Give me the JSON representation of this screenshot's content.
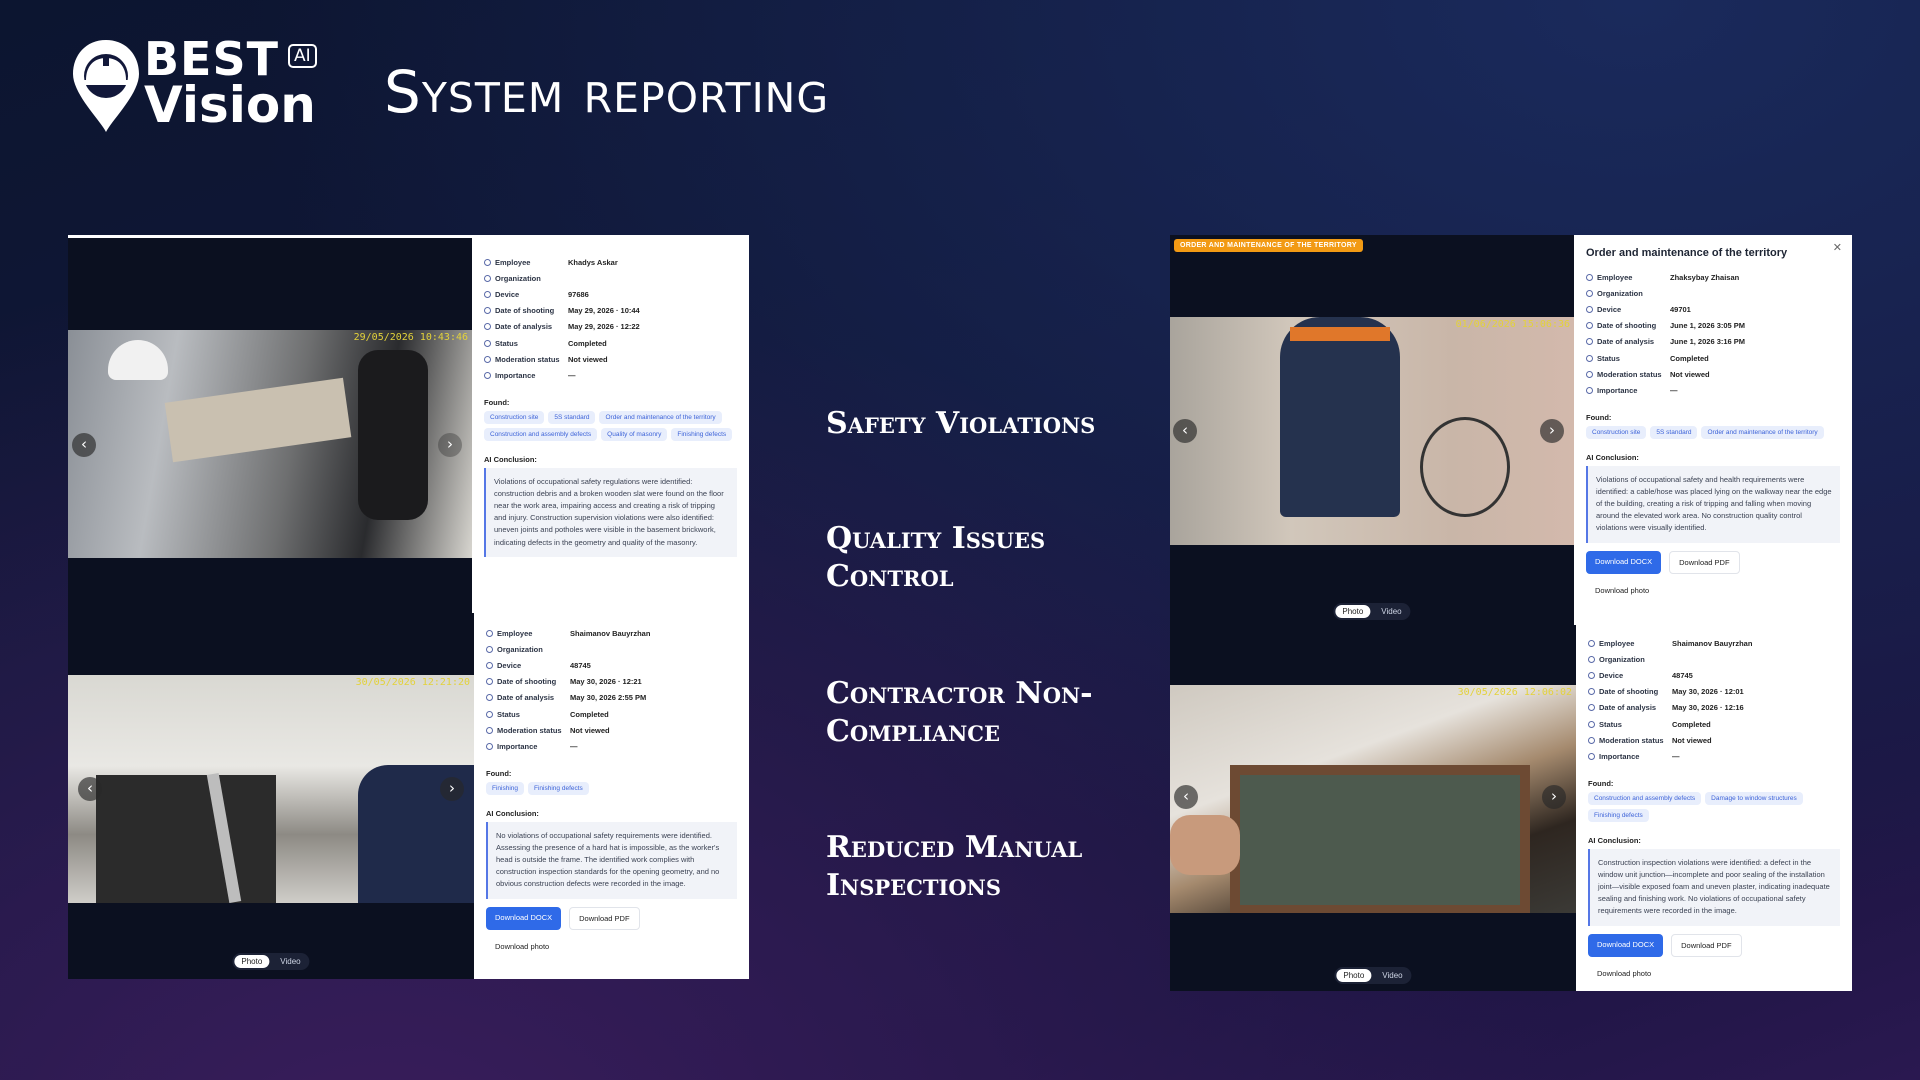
{
  "brand": {
    "line1": "BEST",
    "line2": "Vision",
    "badge": "AI"
  },
  "title": "System reporting",
  "features": [
    "Safety Violations",
    "Quality Issues Control",
    "Contractor Non-Compliance",
    "Reduced Manual Inspections"
  ],
  "labels": {
    "employee": "Employee",
    "organization": "Organization",
    "device": "Device",
    "date_shooting": "Date of shooting",
    "date_analysis": "Date of analysis",
    "status": "Status",
    "moderation": "Moderation status",
    "importance": "Importance",
    "found": "Found:",
    "conclusion": "AI Conclusion:",
    "download_docx": "Download DOCX",
    "download_pdf": "Download PDF",
    "download_photo": "Download photo",
    "photo": "Photo",
    "video": "Video"
  },
  "reports": [
    {
      "timestamp": "29/05/2026 10:43:46",
      "employee": "Khadys Askar",
      "organization": "",
      "device": "97686",
      "date_shooting": "May 29, 2026 · 10:44",
      "date_analysis": "May 29, 2026 · 12:22",
      "status": "Completed",
      "moderation": "Not viewed",
      "importance": "—",
      "found": [
        "Construction site",
        "5S standard",
        "Order and maintenance of the territory",
        "Construction and assembly defects",
        "Quality of masonry",
        "Finishing defects"
      ],
      "conclusion": "Violations of occupational safety regulations were identified: construction debris and a broken wooden slat were found on the floor near the work area, impairing access and creating a risk of tripping and injury. Construction supervision violations were also identified: uneven joints and potholes were visible in the basement brickwork, indicating defects in the geometry and quality of the masonry."
    },
    {
      "timestamp": "30/05/2026 12:21:20",
      "employee": "Shaimanov Bauyrzhan",
      "organization": "",
      "device": "48745",
      "date_shooting": "May 30, 2026 · 12:21",
      "date_analysis": "May 30, 2026 2:55 PM",
      "status": "Completed",
      "moderation": "Not viewed",
      "importance": "—",
      "found": [
        "Finishing",
        "Finishing defects"
      ],
      "conclusion": "No violations of occupational safety requirements were identified. Assessing the presence of a hard hat is impossible, as the worker's head is outside the frame. The identified work complies with construction inspection standards for the opening geometry, and no obvious construction defects were recorded in the image."
    },
    {
      "banner": "ORDER AND MAINTENANCE OF THE TERRITORY",
      "title": "Order and maintenance of the territory",
      "timestamp": "01/06/2026 15:06:36",
      "employee": "Zhaksybay Zhaisan",
      "organization": "",
      "device": "49701",
      "date_shooting": "June 1, 2026 3:05 PM",
      "date_analysis": "June 1, 2026 3:16 PM",
      "status": "Completed",
      "moderation": "Not viewed",
      "importance": "—",
      "found": [
        "Construction site",
        "5S standard",
        "Order and maintenance of the territory"
      ],
      "conclusion": "Violations of occupational safety and health requirements were identified: a cable/hose was placed lying on the walkway near the edge of the building, creating a risk of tripping and falling when moving around the elevated work area. No construction quality control violations were visually identified."
    },
    {
      "timestamp": "30/05/2026 12:06:02",
      "employee": "Shaimanov Bauyrzhan",
      "organization": "",
      "device": "48745",
      "date_shooting": "May 30, 2026 · 12:01",
      "date_analysis": "May 30, 2026 · 12:16",
      "status": "Completed",
      "moderation": "Not viewed",
      "importance": "—",
      "found": [
        "Construction and assembly defects",
        "Damage to window structures",
        "Finishing defects"
      ],
      "conclusion": "Construction inspection violations were identified: a defect in the window unit junction—incomplete and poor sealing of the installation joint—visible exposed foam and uneven plaster, indicating inadequate sealing and finishing work. No violations of occupational safety requirements were recorded in the image."
    }
  ],
  "colors": {
    "accent": "#2f6ae8",
    "banner": "#f29a14",
    "timestamp": "#e3d23a"
  }
}
